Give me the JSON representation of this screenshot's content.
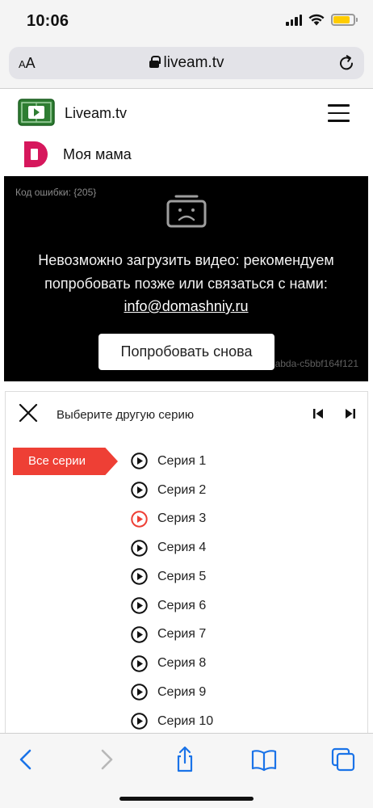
{
  "status_bar": {
    "time": "10:06",
    "battery_level": 0.85
  },
  "browser": {
    "text_size_label_small": "A",
    "text_size_label_large": "A",
    "url": "liveam.tv",
    "icons": [
      "lock-icon",
      "reload-icon"
    ]
  },
  "site": {
    "name": "Liveam.tv",
    "logo_color": "#2e7d32",
    "channel": {
      "name": "Моя мама",
      "logo_color": "#d6175c"
    }
  },
  "player": {
    "error_code": "Код ошибки: {205}",
    "error_message": "Невозможно загрузить видео: рекомендуем попробовать позже или связаться с нами:",
    "error_email": "info@domashniy.ru",
    "retry_label": "Попробовать снова",
    "session_id": "abda-c5bbf164f121"
  },
  "episodes": {
    "title": "Выберите другую серию",
    "all_label": "Все серии",
    "accent_color": "#ee3f35",
    "items": [
      {
        "label": "Серия 1",
        "active": false
      },
      {
        "label": "Серия 2",
        "active": false
      },
      {
        "label": "Серия 3",
        "active": true
      },
      {
        "label": "Серия 4",
        "active": false
      },
      {
        "label": "Серия 5",
        "active": false
      },
      {
        "label": "Серия 6",
        "active": false
      },
      {
        "label": "Серия 7",
        "active": false
      },
      {
        "label": "Серия 8",
        "active": false
      },
      {
        "label": "Серия 9",
        "active": false
      },
      {
        "label": "Серия 10",
        "active": false
      }
    ]
  },
  "toolbar": {
    "icons": [
      "back-icon",
      "forward-icon",
      "share-icon",
      "bookmarks-icon",
      "tabs-icon"
    ],
    "accent_color": "#1a73e8"
  }
}
